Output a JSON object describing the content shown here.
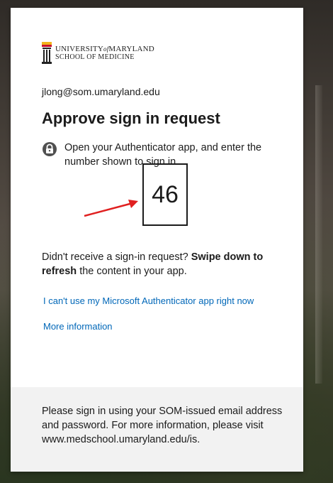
{
  "org": {
    "logo_line1_a": "UNIVERSITY",
    "logo_line1_of": "of",
    "logo_line1_b": "MARYLAND",
    "logo_line2": "SCHOOL OF MEDICINE"
  },
  "identity": {
    "email": "jlong@som.umaryland.edu"
  },
  "main": {
    "title": "Approve sign in request",
    "instruction": "Open your Authenticator app, and enter the number shown to sign in.",
    "code": "46",
    "hint_prefix": "Didn't receive a sign-in request? ",
    "hint_bold": "Swipe down to refresh",
    "hint_suffix": " the content in your app."
  },
  "links": {
    "cant_use": "I can't use my Microsoft Authenticator app right now",
    "more_info": "More information"
  },
  "footer": {
    "text": "Please sign in using your SOM-issued email address and password. For more information, please visit www.medschool.umaryland.edu/is."
  },
  "colors": {
    "link": "#0067b8",
    "arrow": "#e02020",
    "footer_bg": "#f2f2f2"
  },
  "icons": {
    "lock": "lock-icon",
    "arrow": "red-arrow-annotation"
  }
}
